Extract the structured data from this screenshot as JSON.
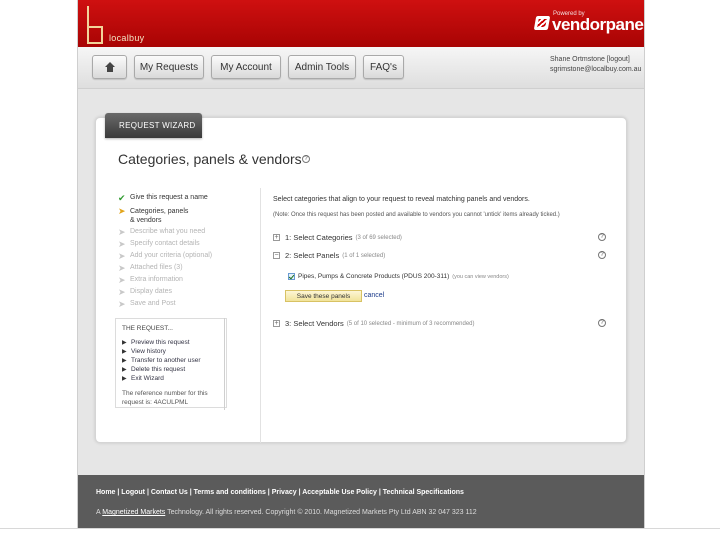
{
  "header": {
    "logo_text": "localbuy",
    "brand_powered": "Powered by",
    "brand_name": "vendorpanel"
  },
  "nav": {
    "buttons": [
      "My Requests",
      "My Account",
      "Admin Tools",
      "FAQ's"
    ],
    "user_line": "Shane Ortmstone [logout]",
    "email_line": "sgrimstone@localbuy.com.au"
  },
  "wizard": {
    "tab_label": "REQUEST WIZARD",
    "title": "Categories, panels & vendors",
    "help_glyph": "?",
    "steps": [
      {
        "label": "Give this request a name",
        "state": "done"
      },
      {
        "label": "Categories, panels & vendors",
        "state": "active"
      },
      {
        "label": "Describe what you need",
        "state": "todo"
      },
      {
        "label": "Specify contact details",
        "state": "todo"
      },
      {
        "label": "Add your criteria (optional)",
        "state": "todo"
      },
      {
        "label": "Attached files (3)",
        "state": "todo"
      },
      {
        "label": "Extra information",
        "state": "todo"
      },
      {
        "label": "Display dates",
        "state": "todo"
      },
      {
        "label": "Save and Post",
        "state": "todo"
      }
    ],
    "request_box": {
      "title": "THE REQUEST...",
      "links": [
        "Preview this request",
        "View history",
        "Transfer to another user",
        "Delete this request",
        "Exit Wizard"
      ],
      "reference": "The reference number for this request is: 4ACULPML"
    }
  },
  "main": {
    "intro": "Select categories that align to your request to reveal matching panels and vendors.",
    "note": "(Note: Once this request has been posted and available to vendors you cannot 'untick' items already ticked.)",
    "sections": [
      {
        "label": "1: Select Categories",
        "sub": "(3 of 69 selected)"
      },
      {
        "label": "2: Select Panels",
        "sub": "(1 of 1 selected)"
      },
      {
        "label": "3: Select Vendors",
        "sub": "(5 of 10 selected - minimum of 3 recommended)"
      }
    ],
    "panel_item": "Pipes, Pumps & Concrete Products (PDUS 200-311)",
    "panel_item_sub": "(you can view vendors)",
    "save_label": "Save these panels",
    "cancel_label": "cancel"
  },
  "footer": {
    "links": "Home | Logout | Contact Us | Terms and conditions | Privacy | Acceptable Use Policy | Technical Specifications",
    "copy_prefix": "A",
    "copy_link": "Magnetized Markets",
    "copy_rest": "Technology. All rights reserved. Copyright © 2010. Magnetized Markets Pty Ltd ABN 32 047 323 112"
  }
}
